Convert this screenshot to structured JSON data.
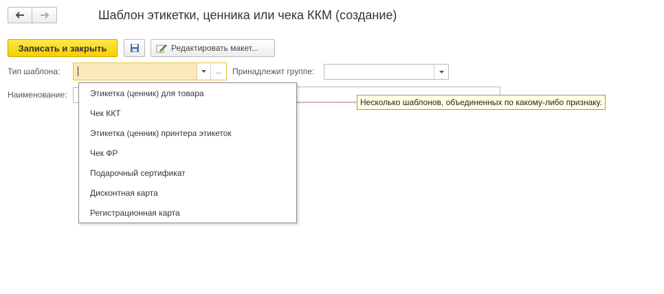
{
  "nav": {
    "back_icon": "arrow-left-icon",
    "forward_icon": "arrow-right-icon"
  },
  "header": {
    "title": "Шаблон этикетки, ценника или чека ККМ (создание)"
  },
  "toolbar": {
    "write_close_label": "Записать и закрыть",
    "save_icon": "floppy-disk-icon",
    "edit_icon": "pencil-icon",
    "edit_label": "Редактировать макет..."
  },
  "form": {
    "template_type_label": "Тип шаблона:",
    "template_type_value": "",
    "select_button": "...",
    "group_label": "Принадлежит группе:",
    "group_value": "",
    "name_label": "Наименование:"
  },
  "tooltip": {
    "text": "Несколько шаблонов, объединенных по какому-либо признаку."
  },
  "dropdown": {
    "items": [
      "Этикетка (ценник) для товара",
      "Чек ККТ",
      "Этикетка (ценник) принтера этикеток",
      "Чек ФР",
      "Подарочный сертификат",
      "Дисконтная карта",
      "Регистрационная карта"
    ]
  },
  "colors": {
    "accent_yellow": "#f6cf00",
    "field_highlight": "#fce9b8",
    "tooltip_bg": "#ffffe1"
  }
}
